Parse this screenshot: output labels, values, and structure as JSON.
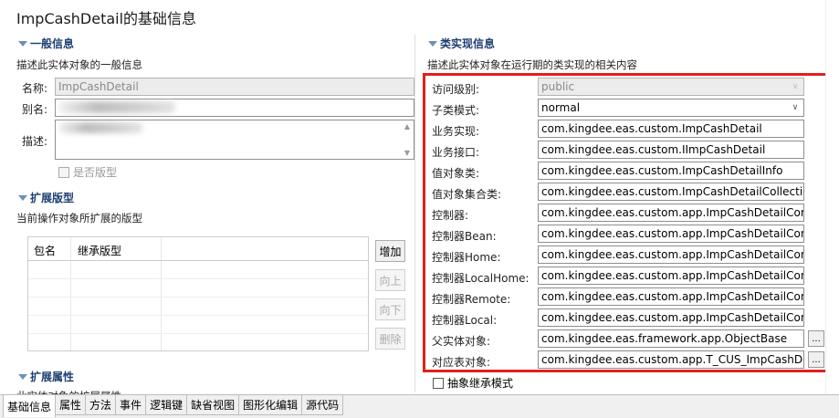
{
  "title": "ImpCashDetail的基础信息",
  "general": {
    "heading": "一般信息",
    "description": "描述此实体对象的一般信息",
    "name_label": "名称:",
    "name_value": "ImpCashDetail",
    "alias_label": "别名:",
    "desc_label": "描述:",
    "is_version_label": "是否版型"
  },
  "ext_version": {
    "heading": "扩展版型",
    "description": "当前操作对象所扩展的版型",
    "columns": [
      "包名",
      "继承版型"
    ],
    "buttons": {
      "add": "增加",
      "up": "向上",
      "down": "向下",
      "delete": "删除"
    }
  },
  "ext_attr": {
    "heading": "扩展属性",
    "description": "此实体对象的扩展属性"
  },
  "class_impl": {
    "heading": "类实现信息",
    "description": "描述此实体对象在运行期的类实现的相关内容",
    "rows": [
      {
        "label": "访问级别:",
        "value": "public"
      },
      {
        "label": "子类模式:",
        "value": "normal"
      },
      {
        "label": "业务实现:",
        "value": "com.kingdee.eas.custom.ImpCashDetail"
      },
      {
        "label": "业务接口:",
        "value": "com.kingdee.eas.custom.IImpCashDetail"
      },
      {
        "label": "值对象类:",
        "value": "com.kingdee.eas.custom.ImpCashDetailInfo"
      },
      {
        "label": "值对象集合类:",
        "value": "com.kingdee.eas.custom.ImpCashDetailCollection"
      },
      {
        "label": "控制器:",
        "value": "com.kingdee.eas.custom.app.ImpCashDetailController"
      },
      {
        "label": "控制器Bean:",
        "value": "com.kingdee.eas.custom.app.ImpCashDetailControllerBean"
      },
      {
        "label": "控制器Home:",
        "value": "com.kingdee.eas.custom.app.ImpCashDetailControllerHome"
      },
      {
        "label": "控制器LocalHome:",
        "value": "com.kingdee.eas.custom.app.ImpCashDetailControllerLocalHome"
      },
      {
        "label": "控制器Remote:",
        "value": "com.kingdee.eas.custom.app.ImpCashDetailControllerRemote"
      },
      {
        "label": "控制器Local:",
        "value": "com.kingdee.eas.custom.app.ImpCashDetailControllerLocal"
      },
      {
        "label": "父实体对象:",
        "value": "com.kingdee.eas.framework.app.ObjectBase"
      },
      {
        "label": "对应表对象:",
        "value": "com.kingdee.eas.custom.app.T_CUS_ImpCashDetail"
      }
    ],
    "ellipsis": "...",
    "abstract_label": "抽象继承模式"
  },
  "tabs": [
    "基础信息",
    "属性",
    "方法",
    "事件",
    "逻辑键",
    "缺省视图",
    "图形化编辑",
    "源代码"
  ],
  "active_tab": 0
}
